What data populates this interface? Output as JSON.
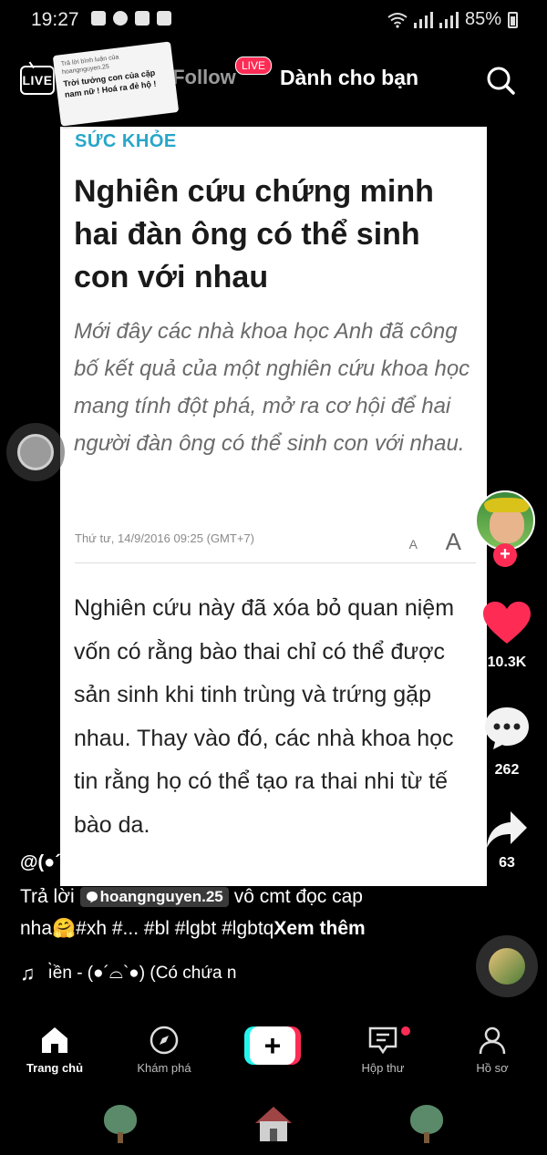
{
  "status_bar": {
    "time": "19:27",
    "battery": "85%"
  },
  "top_nav": {
    "live_label": "LIVE",
    "following": "Đang Follow",
    "live_badge": "LIVE",
    "for_you": "Dành cho bạn"
  },
  "reply_sticker": {
    "small": "Trả lời bình luận của hoangnguyen.25",
    "text": "Trời tưởng con của cặp nam nữ ! Hoá ra đẻ hộ !"
  },
  "article": {
    "category": "SỨC KHỎE",
    "headline": "Nghiên cứu chứng minh hai đàn ông có thể sinh con với nhau",
    "lead": "Mới đây các nhà khoa học Anh đã công bố kết quả của một nghiên cứu khoa học mang tính đột phá, mở ra cơ hội để hai người đàn ông có thể sinh con với nhau.",
    "meta": "Thứ tư, 14/9/2016 09:25 (GMT+7)",
    "font_small": "A",
    "font_big": "A",
    "body": "Nghiên cứu này đã xóa bỏ quan niệm vốn có rằng bào thai chỉ có thể được sản sinh khi tinh trùng và trứng gặp nhau. Thay vào đó, các nhà khoa học tin rằng họ có thể tạo ra thai nhi từ tế bào da."
  },
  "side_rail": {
    "likes": "10.3K",
    "comments": "262",
    "shares": "63"
  },
  "caption": {
    "username": "@(●´⌓`●)",
    "reply_prefix": "Trả lời",
    "mention": "hoangnguyen.25",
    "line1_rest": "vô cmt đọc cap",
    "line2": "nha🤗#xh #... #bl #lgbt #lgbtq",
    "see_more": "Xem thêm",
    "music": "ı̀ền - (●´⌓`●) (Có chứa n"
  },
  "bottom_nav": {
    "home": "Trang chủ",
    "discover": "Khám phá",
    "inbox": "Hộp thư",
    "profile": "Hồ sơ"
  },
  "colors": {
    "accent_red": "#fe2c55",
    "accent_cyan": "#25f4ee",
    "category_blue": "#27a6c9"
  }
}
